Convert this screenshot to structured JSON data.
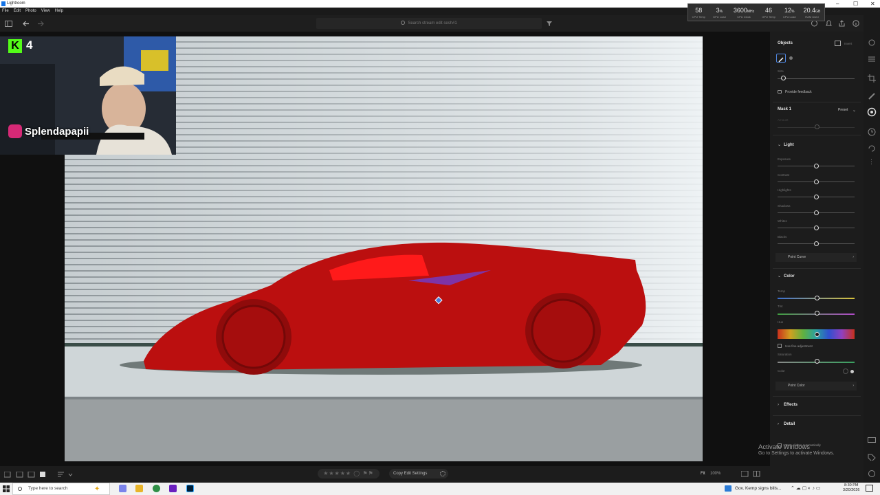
{
  "window": {
    "title": "Lightroom",
    "min": "–",
    "max": "☐",
    "close": "✕"
  },
  "menu": [
    "File",
    "Edit",
    "Photo",
    "View",
    "Help"
  ],
  "perf": [
    {
      "value": "58",
      "unit": "",
      "label": "CPU Temp"
    },
    {
      "value": "3",
      "unit": "%",
      "label": "GPU Load"
    },
    {
      "value": "3600",
      "unit": "MHz",
      "label": "CPU Clock"
    },
    {
      "value": "46",
      "unit": "",
      "label": "GPU Temp"
    },
    {
      "value": "12",
      "unit": "%",
      "label": "CPU Load"
    },
    {
      "value": "20.4",
      "unit": "GB",
      "label": "RAM Used"
    }
  ],
  "toolbar": {
    "search_placeholder": "Search stream edit sesh#1"
  },
  "webcam": {
    "badge": "4",
    "handle": "Splendapapii"
  },
  "panel": {
    "section": "Objects",
    "invert": "Invert",
    "size_label": "Size",
    "feedback": "Provide feedback",
    "mask_name": "Mask 1",
    "preset": "Preset",
    "amount_label": "Amount",
    "light": "Light",
    "light_sliders": [
      {
        "name": "Exposure",
        "value": 0.5
      },
      {
        "name": "Contrast",
        "value": 0.5
      },
      {
        "name": "Highlights",
        "value": 0.5
      },
      {
        "name": "Shadows",
        "value": 0.5
      },
      {
        "name": "Whites",
        "value": 0.5
      },
      {
        "name": "Blacks",
        "value": 0.5
      }
    ],
    "point_curve": "Point Curve",
    "color": "Color",
    "temp_label": "Temp",
    "tint_label": "Tint",
    "hue_label": "Hue",
    "fine_adjust": "Use fine adjustment",
    "saturation_label": "Saturation",
    "color_label": "Color",
    "point_color": "Point Color",
    "effects": "Effects",
    "detail": "Detail",
    "auto_label": "Open sliders automatically"
  },
  "bottombar": {
    "copy": "Copy Edit Settings",
    "fit": "Fit",
    "zoom": "100%"
  },
  "activate": {
    "line1": "Activate Windows",
    "line2": "Go to Settings to activate Windows."
  },
  "taskbar": {
    "search": "Type here to search",
    "news": "Gov. Kemp signs bills...",
    "time": "8:30 PM",
    "date": "3/20/2026"
  },
  "colors": {
    "accent": "#1473e6",
    "mask": "#c81414",
    "panel": "#1c1c1c"
  }
}
